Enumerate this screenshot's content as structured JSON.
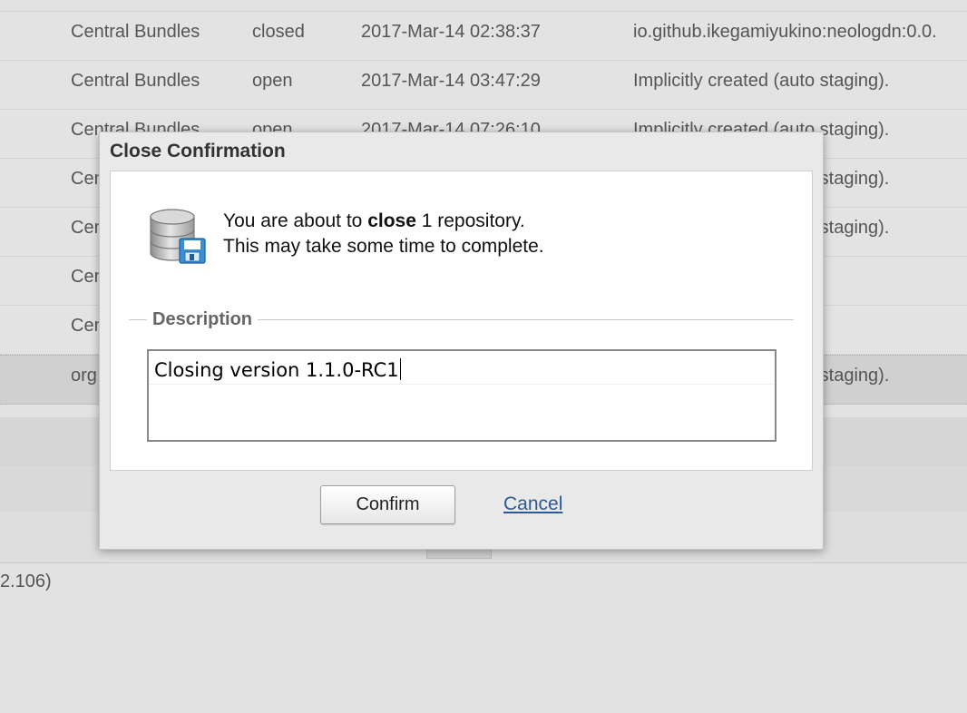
{
  "table": {
    "rows": [
      {
        "profile": "Central Bundles",
        "status": "closed",
        "updated": "2017-Mar-14 02:38:37",
        "description": "io.github.ikegamiyukino:neologdn:0.0."
      },
      {
        "profile": "Central Bundles",
        "status": "open",
        "updated": "2017-Mar-14 03:47:29",
        "description": "Implicitly created (auto staging)."
      },
      {
        "profile": "Central Bundles",
        "status": "open",
        "updated": "2017-Mar-14 07:26:10",
        "description": "Implicitly created (auto staging)."
      },
      {
        "profile": "Central Bundles",
        "status": "",
        "updated": "",
        "description": "Implicitly created (auto staging)."
      },
      {
        "profile": "Central Bundles",
        "status": "",
        "updated": "",
        "description": "Implicitly created (auto staging)."
      },
      {
        "profile": "Central Bundles",
        "status": "",
        "updated": "",
        "description": ""
      },
      {
        "profile": "Central Bundles",
        "status": "",
        "updated": "",
        "description": ""
      },
      {
        "profile": "org",
        "status": "",
        "updated": "",
        "description": "Implicitly created (auto staging)."
      }
    ]
  },
  "footer": {
    "version_text": "2.106)"
  },
  "dialog": {
    "title": "Close Confirmation",
    "message_prefix": "You are about to ",
    "message_action": "close",
    "message_suffix": " 1 repository.",
    "message_line2": "This may take some time to complete.",
    "description_legend": "Description",
    "description_value": "Closing version 1.1.0-RC1",
    "confirm_label": "Confirm",
    "cancel_label": "Cancel",
    "icon": "database-save-icon"
  },
  "colors": {
    "link": "#2b5a92",
    "background": "#e2e2e2",
    "dialog_background": "#e9e9e9"
  }
}
